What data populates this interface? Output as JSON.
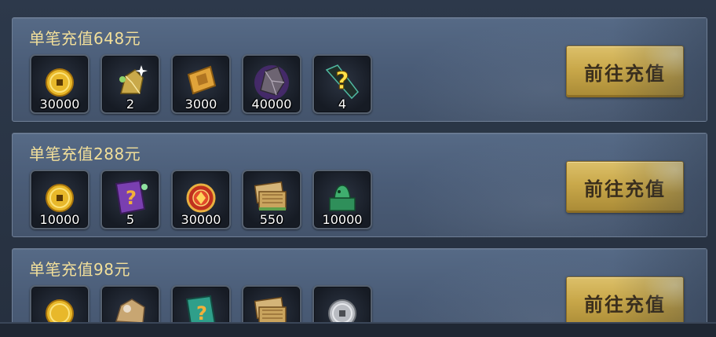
{
  "tiers": [
    {
      "title": "单笔充值648元",
      "button_label": "前往充值",
      "items": [
        {
          "icon": "gold-coin-icon",
          "qty": "30000"
        },
        {
          "icon": "gold-ore-icon",
          "qty": "2"
        },
        {
          "icon": "gold-scroll-icon",
          "qty": "3000"
        },
        {
          "icon": "purple-crystal-icon",
          "qty": "40000"
        },
        {
          "icon": "mystery-card-icon",
          "qty": "4"
        }
      ]
    },
    {
      "title": "单笔充值288元",
      "button_label": "前往充值",
      "items": [
        {
          "icon": "gold-coin-icon",
          "qty": "10000"
        },
        {
          "icon": "purple-mystery-book-icon",
          "qty": "5"
        },
        {
          "icon": "red-token-icon",
          "qty": "30000"
        },
        {
          "icon": "bamboo-scrolls-icon",
          "qty": "550"
        },
        {
          "icon": "jade-seal-icon",
          "qty": "10000"
        }
      ]
    },
    {
      "title": "单笔充值98元",
      "button_label": "前往充值",
      "items": [
        {
          "icon": "gold-coin-icon",
          "qty": ""
        },
        {
          "icon": "raw-ore-icon",
          "qty": ""
        },
        {
          "icon": "green-mystery-book-icon",
          "qty": ""
        },
        {
          "icon": "bamboo-scrolls-icon",
          "qty": ""
        },
        {
          "icon": "silver-coin-icon",
          "qty": ""
        }
      ]
    }
  ]
}
